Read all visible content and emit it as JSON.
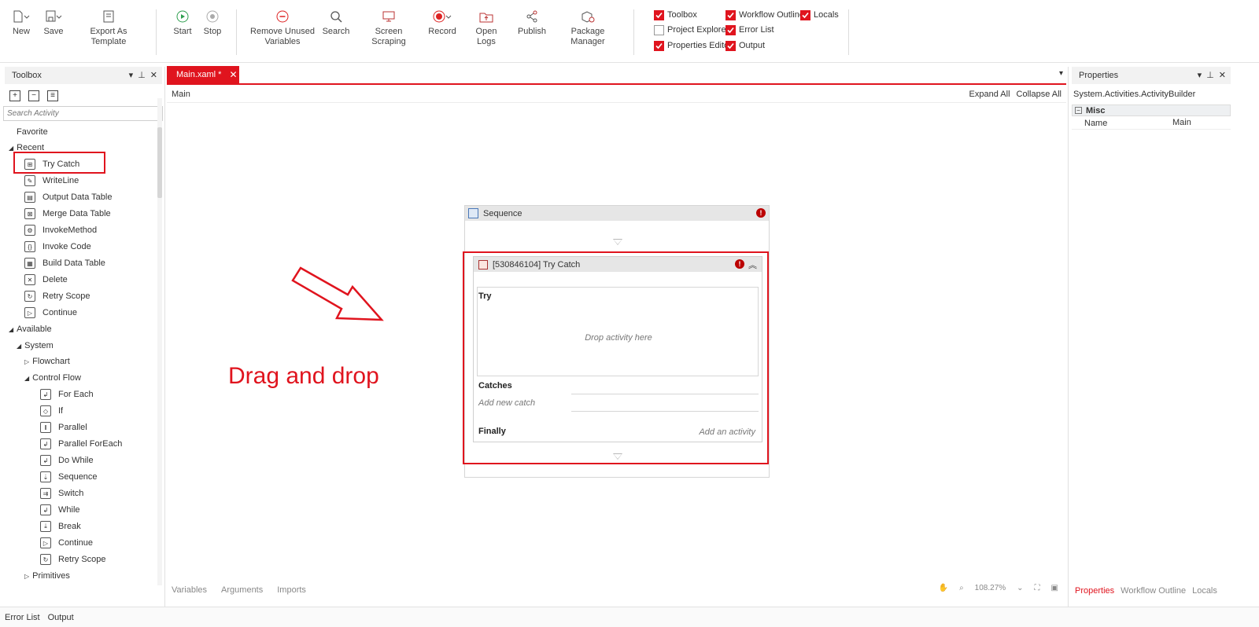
{
  "ribbon": {
    "buttons": [
      {
        "label": "New",
        "icon": "new-file-icon"
      },
      {
        "label": "Save",
        "icon": "save-icon"
      },
      {
        "label": "Export As Template",
        "icon": "export-template-icon"
      },
      {
        "label": "Start",
        "icon": "play-icon"
      },
      {
        "label": "Stop",
        "icon": "stop-icon"
      },
      {
        "label": "Remove Unused Variables",
        "icon": "remove-variables-icon"
      },
      {
        "label": "Search",
        "icon": "search-icon"
      },
      {
        "label": "Screen Scraping",
        "icon": "screen-scraping-icon"
      },
      {
        "label": "Record",
        "icon": "record-icon"
      },
      {
        "label": "Open Logs",
        "icon": "open-logs-icon"
      },
      {
        "label": "Publish",
        "icon": "publish-icon"
      },
      {
        "label": "Package Manager",
        "icon": "package-manager-icon"
      }
    ],
    "panels": [
      {
        "label": "Toolbox",
        "checked": true
      },
      {
        "label": "Project Explorer",
        "checked": false
      },
      {
        "label": "Properties Editor",
        "checked": true
      },
      {
        "label": "Workflow Outline",
        "checked": true
      },
      {
        "label": "Error List",
        "checked": true
      },
      {
        "label": "Output",
        "checked": true
      },
      {
        "label": "Locals",
        "checked": true
      }
    ]
  },
  "toolbox": {
    "title": "Toolbox",
    "search_placeholder": "Search Activity",
    "favorite": "Favorite",
    "recent": "Recent",
    "recent_items": [
      "Try Catch",
      "WriteLine",
      "Output Data Table",
      "Merge Data Table",
      "InvokeMethod",
      "Invoke Code",
      "Build Data Table",
      "Delete",
      "Retry Scope",
      "Continue"
    ],
    "available": "Available",
    "system": "System",
    "flowchart": "Flowchart",
    "control_flow": "Control Flow",
    "control_flow_items": [
      "For Each",
      "If",
      "Parallel",
      "Parallel ForEach",
      "Do While",
      "Sequence",
      "Switch",
      "While",
      "Break",
      "Continue",
      "Retry Scope"
    ],
    "primitives": "Primitives"
  },
  "designer": {
    "tab_label": "Main.xaml *",
    "breadcrumb": "Main",
    "expand_all": "Expand All",
    "collapse_all": "Collapse All",
    "annotation": "Drag and drop",
    "sequence_title": "Sequence",
    "try_catch_title": "[530846104] Try Catch",
    "try_label": "Try",
    "drop_hint": "Drop activity here",
    "catches_label": "Catches",
    "add_catch": "Add new catch",
    "finally_label": "Finally",
    "add_activity": "Add an activity",
    "bottom_tabs": [
      "Variables",
      "Arguments",
      "Imports"
    ],
    "zoom": "108.27%"
  },
  "properties": {
    "title": "Properties",
    "type_name": "System.Activities.ActivityBuilder",
    "category": "Misc",
    "rows": [
      {
        "name": "Name",
        "value": "Main"
      }
    ],
    "tabs": [
      "Properties",
      "Workflow Outline",
      "Locals"
    ]
  },
  "status_bar": {
    "links": [
      "Error List",
      "Output"
    ]
  },
  "colors": {
    "accent": "#e0141e",
    "panel_header": "#f2f2f2",
    "error": "#bb0000"
  }
}
